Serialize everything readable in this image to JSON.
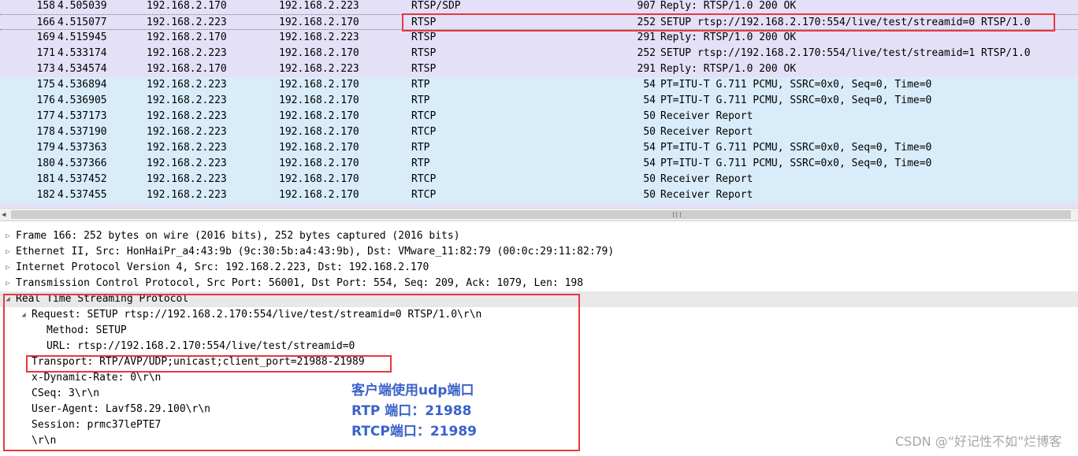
{
  "packets": [
    {
      "no": "158",
      "time": "4.505039",
      "src": "192.168.2.170",
      "dst": "192.168.2.223",
      "proto": "RTSP/SDP",
      "len": "907",
      "info": "Reply: RTSP/1.0 200 OK",
      "kind": "rtsp"
    },
    {
      "no": "166",
      "time": "4.515077",
      "src": "192.168.2.223",
      "dst": "192.168.2.170",
      "proto": "RTSP",
      "len": "252",
      "info": "SETUP rtsp://192.168.2.170:554/live/test/streamid=0 RTSP/1.0",
      "kind": "selected"
    },
    {
      "no": "169",
      "time": "4.515945",
      "src": "192.168.2.170",
      "dst": "192.168.2.223",
      "proto": "RTSP",
      "len": "291",
      "info": "Reply: RTSP/1.0 200 OK",
      "kind": "rtsp"
    },
    {
      "no": "171",
      "time": "4.533174",
      "src": "192.168.2.223",
      "dst": "192.168.2.170",
      "proto": "RTSP",
      "len": "252",
      "info": "SETUP rtsp://192.168.2.170:554/live/test/streamid=1 RTSP/1.0",
      "kind": "rtsp"
    },
    {
      "no": "173",
      "time": "4.534574",
      "src": "192.168.2.170",
      "dst": "192.168.2.223",
      "proto": "RTSP",
      "len": "291",
      "info": "Reply: RTSP/1.0 200 OK",
      "kind": "rtsp"
    },
    {
      "no": "175",
      "time": "4.536894",
      "src": "192.168.2.223",
      "dst": "192.168.2.170",
      "proto": "RTP",
      "len": "54",
      "info": "PT=ITU-T G.711 PCMU, SSRC=0x0, Seq=0, Time=0",
      "kind": "rtp"
    },
    {
      "no": "176",
      "time": "4.536905",
      "src": "192.168.2.223",
      "dst": "192.168.2.170",
      "proto": "RTP",
      "len": "54",
      "info": "PT=ITU-T G.711 PCMU, SSRC=0x0, Seq=0, Time=0",
      "kind": "rtp"
    },
    {
      "no": "177",
      "time": "4.537173",
      "src": "192.168.2.223",
      "dst": "192.168.2.170",
      "proto": "RTCP",
      "len": "50",
      "info": "Receiver Report",
      "kind": "rtp"
    },
    {
      "no": "178",
      "time": "4.537190",
      "src": "192.168.2.223",
      "dst": "192.168.2.170",
      "proto": "RTCP",
      "len": "50",
      "info": "Receiver Report",
      "kind": "rtp"
    },
    {
      "no": "179",
      "time": "4.537363",
      "src": "192.168.2.223",
      "dst": "192.168.2.170",
      "proto": "RTP",
      "len": "54",
      "info": "PT=ITU-T G.711 PCMU, SSRC=0x0, Seq=0, Time=0",
      "kind": "rtp"
    },
    {
      "no": "180",
      "time": "4.537366",
      "src": "192.168.2.223",
      "dst": "192.168.2.170",
      "proto": "RTP",
      "len": "54",
      "info": "PT=ITU-T G.711 PCMU, SSRC=0x0, Seq=0, Time=0",
      "kind": "rtp"
    },
    {
      "no": "181",
      "time": "4.537452",
      "src": "192.168.2.223",
      "dst": "192.168.2.170",
      "proto": "RTCP",
      "len": "50",
      "info": "Receiver Report",
      "kind": "rtp"
    },
    {
      "no": "182",
      "time": "4.537455",
      "src": "192.168.2.223",
      "dst": "192.168.2.170",
      "proto": "RTCP",
      "len": "50",
      "info": "Receiver Report",
      "kind": "rtp"
    }
  ],
  "details": [
    {
      "text": "Frame 166: 252 bytes on wire (2016 bits), 252 bytes captured (2016 bits)",
      "level": 0,
      "toggle": "collapsed"
    },
    {
      "text": "Ethernet II, Src: HonHaiPr_a4:43:9b (9c:30:5b:a4:43:9b), Dst: VMware_11:82:79 (00:0c:29:11:82:79)",
      "level": 0,
      "toggle": "collapsed"
    },
    {
      "text": "Internet Protocol Version 4, Src: 192.168.2.223, Dst: 192.168.2.170",
      "level": 0,
      "toggle": "collapsed"
    },
    {
      "text": "Transmission Control Protocol, Src Port: 56001, Dst Port: 554, Seq: 209, Ack: 1079, Len: 198",
      "level": 0,
      "toggle": "collapsed"
    },
    {
      "text": "Real Time Streaming Protocol",
      "level": 0,
      "toggle": "expanded"
    },
    {
      "text": "Request: SETUP rtsp://192.168.2.170:554/live/test/streamid=0 RTSP/1.0\\r\\n",
      "level": 1,
      "toggle": "expanded"
    },
    {
      "text": "Method: SETUP",
      "level": 2,
      "toggle": "none"
    },
    {
      "text": "URL: rtsp://192.168.2.170:554/live/test/streamid=0",
      "level": 2,
      "toggle": "none"
    },
    {
      "text": "Transport: RTP/AVP/UDP;unicast;client_port=21988-21989",
      "level": 1,
      "toggle": "none"
    },
    {
      "text": "x-Dynamic-Rate: 0\\r\\n",
      "level": 1,
      "toggle": "none"
    },
    {
      "text": "CSeq: 3\\r\\n",
      "level": 1,
      "toggle": "none"
    },
    {
      "text": "User-Agent: Lavf58.29.100\\r\\n",
      "level": 1,
      "toggle": "none"
    },
    {
      "text": "Session: prmc37lePTE7",
      "level": 1,
      "toggle": "none"
    },
    {
      "text": "\\r\\n",
      "level": 1,
      "toggle": "none"
    }
  ],
  "annotation": {
    "line1": "客户端使用udp端口",
    "line2": "RTP 端口：21988",
    "line3": "RTCP端口：21989"
  },
  "watermark": "CSDN @“好记性不如”烂博客",
  "colors": {
    "rtsp_row": "#e4e0f7",
    "rtp_row": "#d8ecf9",
    "highlight_box": "#e8383d",
    "annotation_text": "#3a62c9"
  },
  "icons": {
    "collapsed": "triangle-right-icon",
    "expanded": "triangle-down-icon"
  }
}
